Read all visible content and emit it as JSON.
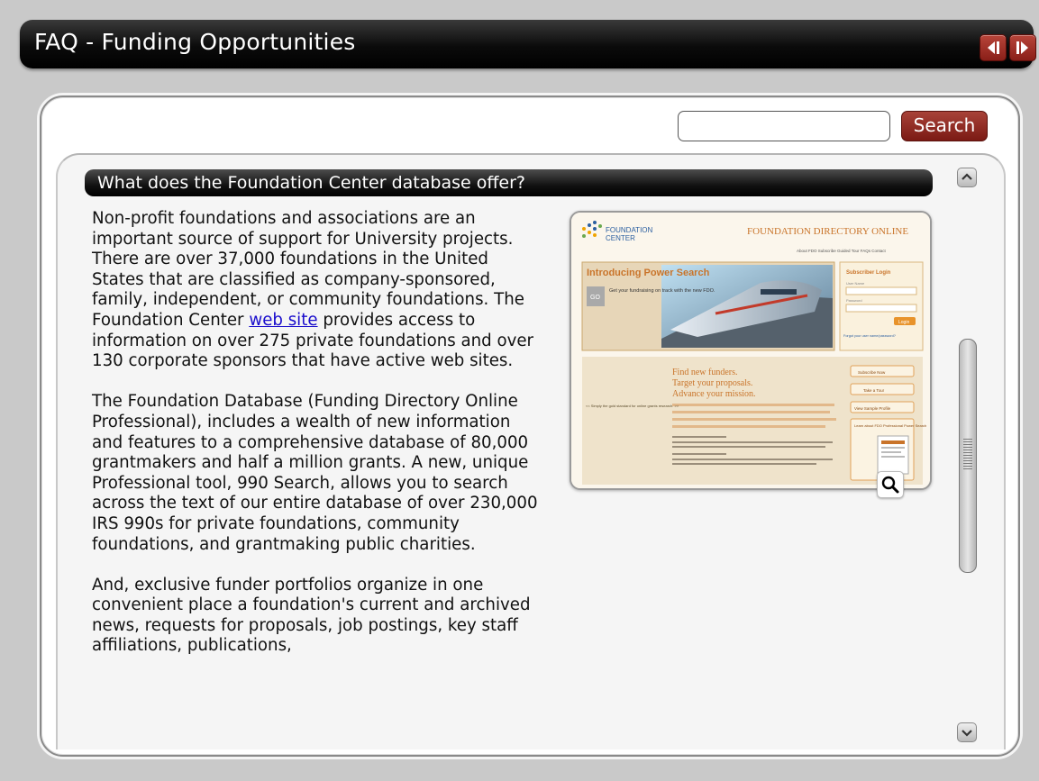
{
  "window": {
    "title": "FAQ - Funding Opportunities",
    "prev_icon": "previous-page-icon",
    "next_icon": "next-page-icon"
  },
  "search": {
    "value": "",
    "placeholder": "",
    "button_label": "Search"
  },
  "article": {
    "question": "What does the Foundation Center database offer?",
    "p1_before_link": "Non-profit foundations and associations are an important source of support for University projects. There are over 37,000 foundations in the United States that are classified as company-sponsored, family, independent, or community foundations. The Foundation Center ",
    "p1_link": "web site",
    "p1_after_link": " provides access to information on over 275 private foundations and over 130 corporate sponsors that have active web sites.",
    "p2": "The Foundation Database (Funding Directory Online Professional), includes a wealth of new information and features to a comprehensive database of 80,000 grantmakers and half a million grants. A new, unique Professional tool, 990 Search, allows you to search across the text of our entire database of over 230,000 IRS 990s for private foundations, community foundations, and grantmaking public charities.",
    "p3": "And, exclusive funder portfolios organize in one convenient place a foundation's current and archived news, requests for proposals, job postings, key staff affiliations, publications,"
  },
  "screenshot": {
    "logo_text": "FOUNDATION",
    "logo_text2": "CENTER",
    "site_title": "FOUNDATION DIRECTORY ONLINE",
    "nav_links": "About FDO  Subscribe  Guided Tour  FAQs  Contact",
    "hero_title": "Introducing Power Search",
    "hero_go": "GO",
    "hero_tagline": "Get your fundraising on track with the new FDO.",
    "login_title": "Subscriber Login",
    "login_user": "User Name",
    "login_pass": "Password",
    "login_button": "Login",
    "login_forgot": "Forgot your user name/password?",
    "promo_line1": "Find new funders.",
    "promo_line2": "Target your proposals.",
    "promo_line3": "Advance your mission.",
    "quote": "<< Simply the gold standard for online grants research. >>",
    "btn1": "Subscribe Now",
    "btn2": "Take a Tour",
    "btn3": "View Sample Profile",
    "learn": "Learn about FDO Professional Power Search"
  },
  "icons": {
    "zoom": "magnifier-icon",
    "scroll_up": "chevron-up-icon",
    "scroll_down": "chevron-down-icon"
  },
  "colors": {
    "accent": "#8a2a22",
    "title_bar": "#000000",
    "link": "#1a0dcc"
  }
}
